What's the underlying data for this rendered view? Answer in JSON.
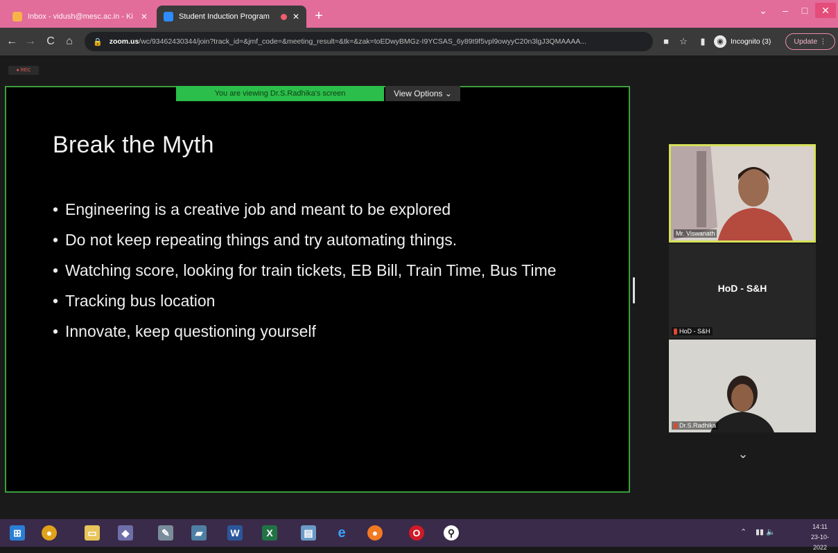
{
  "browser": {
    "tabs": [
      {
        "label": "Inbox - vidush@mesc.ac.in - Ki"
      },
      {
        "label": "Student Induction Program"
      }
    ],
    "new_tab_label": "+",
    "window_buttons": {
      "chevron": "⌄",
      "minimize": "–",
      "maximize": "□",
      "close": "✕"
    },
    "nav": {
      "back": "←",
      "forward": "→",
      "reload": "C",
      "home": "⌂"
    },
    "url_host": "zoom.us",
    "url_rest": "/wc/93462430344/join?track_id=&jmf_code=&meeting_result=&tk=&zak=toEDwyBMGz-I9YCSAS_6y89t9f5vpl9owyyC20n3lgJ3QMAAAA...",
    "incognito_label": "Incognito (3)",
    "update_label": "Update"
  },
  "zoom": {
    "rec_label": "● REC",
    "viewing_banner": "You are viewing Dr.S.Radhika's screen",
    "view_options": "View Options ⌄",
    "slide": {
      "title": "Break the Myth",
      "bullets": [
        "Engineering is a creative job and meant to be explored",
        "Do not keep repeating things and try automating things.",
        "Watching score, looking for train tickets, EB Bill, Train Time, Bus Time",
        "Tracking bus location",
        "Innovate, keep questioning yourself"
      ]
    },
    "participants": [
      {
        "name": "Mr. Viswanath"
      },
      {
        "name": "HoD - S&H",
        "center_label": "HoD - S&H"
      },
      {
        "name": "Dr.S.Radhika"
      }
    ],
    "scroll_chevron": "⌄"
  },
  "taskbar": {
    "clock_time": "14:11",
    "clock_date": "23-10-2022"
  },
  "colors": {
    "chrome_tabstrip": "#e26c9a",
    "share_border": "#3c9d3c",
    "viewing_banner": "#2bbe4a",
    "active_speaker": "#d6e05a"
  }
}
